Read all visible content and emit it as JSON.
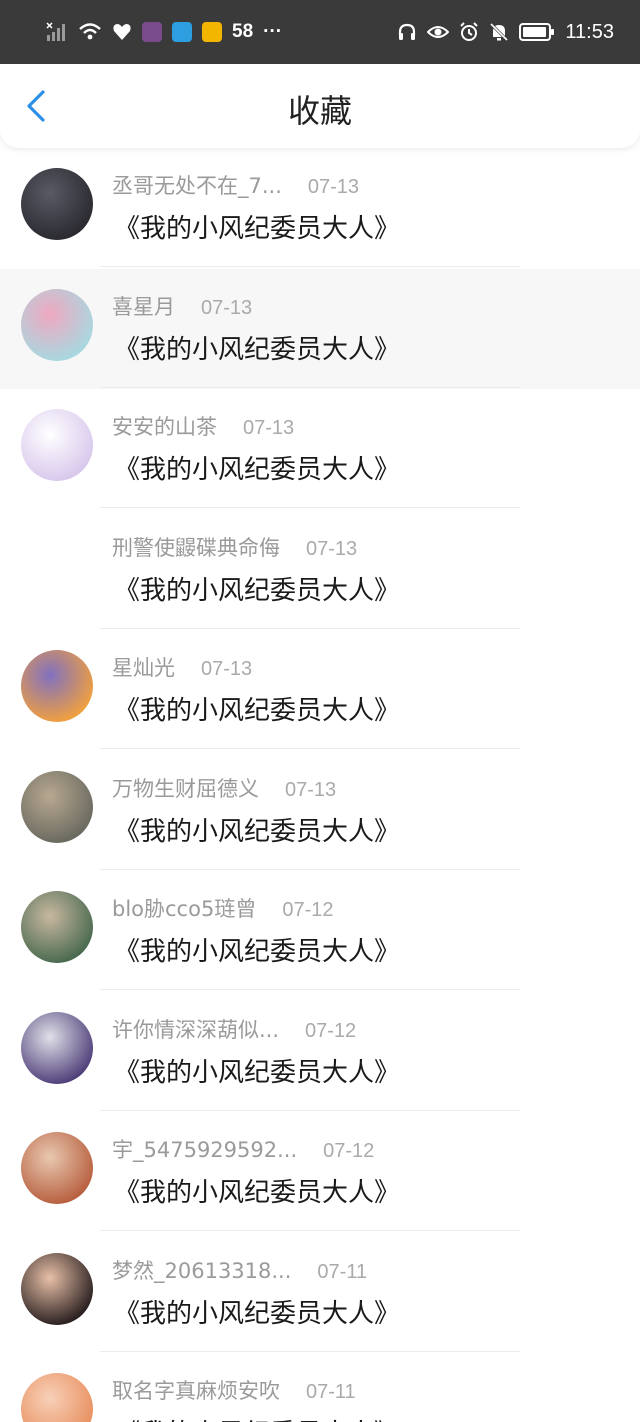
{
  "status_bar": {
    "battery_count": "58",
    "overflow": "···",
    "time": "11:53",
    "icons": [
      "signal-icon",
      "wifi-icon",
      "health-icon",
      "app-avatar-icon",
      "search-app-icon",
      "weibo-icon",
      "headphones-icon",
      "eye-icon",
      "alarm-icon",
      "mute-icon",
      "battery-icon"
    ],
    "app_badge_colors": [
      "#7a4b8c",
      "#2d9ee0",
      "#f2b500"
    ]
  },
  "header": {
    "title": "收藏",
    "back_color": "#2e8fe6"
  },
  "items": [
    {
      "username": "丞哥无处不在_7...",
      "date": "07-13",
      "book": "《我的小风纪委员大人》",
      "avatar_colors": [
        "#2a2a30",
        "#5a5a66"
      ]
    },
    {
      "username": "喜星月",
      "date": "07-13",
      "book": "《我的小风纪委员大人》",
      "avatar_colors": [
        "#a8d8e0",
        "#f0a8c0"
      ]
    },
    {
      "username": "安安的山茶",
      "date": "07-13",
      "book": "《我的小风纪委员大人》",
      "avatar_colors": [
        "#d8c8ec",
        "#ffffff"
      ]
    },
    {
      "username": "刑警使鼹碟典命侮",
      "date": "07-13",
      "book": "《我的小风纪委员大人》",
      "avatar_colors": []
    },
    {
      "username": "星灿光",
      "date": "07-13",
      "book": "《我的小风纪委员大人》",
      "avatar_colors": [
        "#f0a040",
        "#8070c0"
      ]
    },
    {
      "username": "万物生财屈德义",
      "date": "07-13",
      "book": "《我的小风纪委员大人》",
      "avatar_colors": [
        "#6a6a60",
        "#b8a890"
      ]
    },
    {
      "username": "blo胁cco5琏曾",
      "date": "07-12",
      "book": "《我的小风纪委员大人》",
      "avatar_colors": [
        "#4a6a50",
        "#c8b8a0"
      ]
    },
    {
      "username": "许你情深深葫似...",
      "date": "07-12",
      "book": "《我的小风纪委员大人》",
      "avatar_colors": [
        "#50407a",
        "#e0e0e8"
      ]
    },
    {
      "username": "宇_5475929592...",
      "date": "07-12",
      "book": "《我的小风纪委员大人》",
      "avatar_colors": [
        "#b86040",
        "#e8c8b0"
      ]
    },
    {
      "username": "梦然_20613318...",
      "date": "07-11",
      "book": "《我的小风纪委员大人》",
      "avatar_colors": [
        "#2a2020",
        "#e8c0a8"
      ]
    },
    {
      "username": "取名字真麻烦安吹",
      "date": "07-11",
      "book": "《我的小风纪委员大人》",
      "avatar_colors": [
        "#e89060",
        "#f8d0b8"
      ]
    }
  ]
}
